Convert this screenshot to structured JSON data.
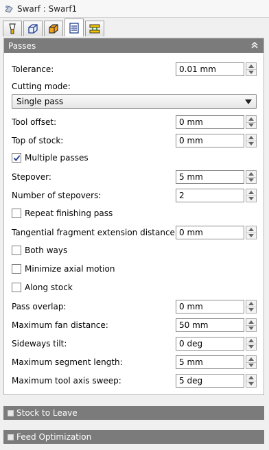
{
  "window": {
    "title": "Swarf : Swarf1"
  },
  "tabs": [
    {
      "icon": "tool-icon"
    },
    {
      "icon": "geometry-icon"
    },
    {
      "icon": "heights-icon"
    },
    {
      "icon": "passes-icon",
      "active": true
    },
    {
      "icon": "linking-icon"
    }
  ],
  "passes": {
    "header": "Passes",
    "tolerance": {
      "label": "Tolerance:",
      "value": "0.01 mm"
    },
    "cutting_mode": {
      "label": "Cutting mode:",
      "value": "Single pass"
    },
    "tool_offset": {
      "label": "Tool offset:",
      "value": "0 mm"
    },
    "top_of_stock": {
      "label": "Top of stock:",
      "value": "0 mm"
    },
    "multiple_passes": {
      "label": "Multiple passes",
      "checked": true
    },
    "stepover": {
      "label": "Stepover:",
      "value": "5 mm"
    },
    "number_of_stepovers": {
      "label": "Number of stepovers:",
      "value": "2"
    },
    "repeat_finishing_pass": {
      "label": "Repeat finishing pass",
      "checked": false
    },
    "tangential_extension": {
      "label": "Tangential fragment extension distance:",
      "value": "0 mm"
    },
    "both_ways": {
      "label": "Both ways",
      "checked": false
    },
    "minimize_axial_motion": {
      "label": "Minimize axial motion",
      "checked": false
    },
    "along_stock": {
      "label": "Along stock",
      "checked": false
    },
    "pass_overlap": {
      "label": "Pass overlap:",
      "value": "0 mm"
    },
    "max_fan_distance": {
      "label": "Maximum fan distance:",
      "value": "50 mm"
    },
    "sideways_tilt": {
      "label": "Sideways tilt:",
      "value": "0 deg"
    },
    "max_segment_length": {
      "label": "Maximum segment length:",
      "value": "5 mm"
    },
    "max_tool_axis_sweep": {
      "label": "Maximum tool axis sweep:",
      "value": "5 deg"
    }
  },
  "sections": {
    "stock_to_leave": "Stock to Leave",
    "feed_optimization": "Feed Optimization"
  },
  "colors": {
    "header_bg": "#7b7b7b",
    "panel_bg": "#ffffff",
    "window_bg": "#f0f0f0"
  }
}
